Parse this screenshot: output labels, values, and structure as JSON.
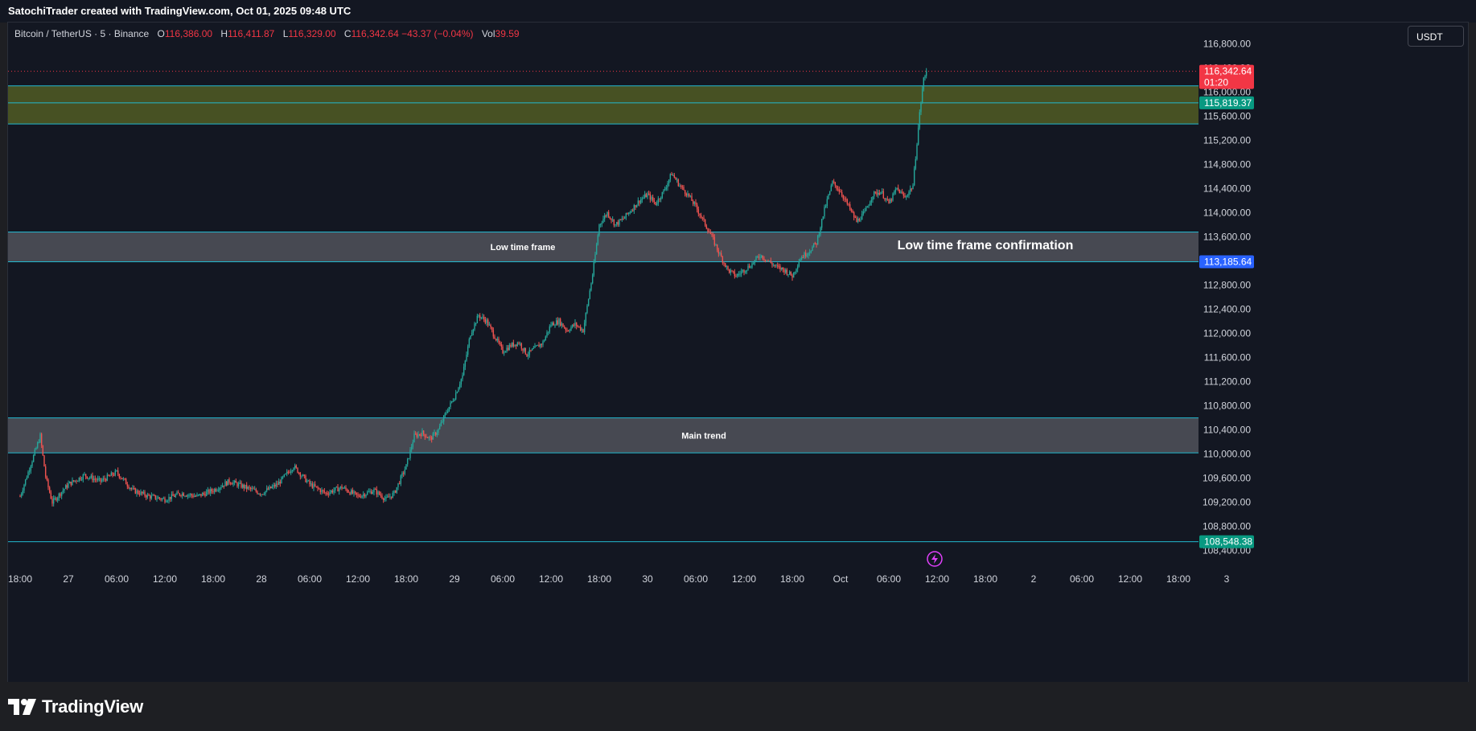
{
  "header": {
    "title": "SatochiTrader created with TradingView.com, Oct 01, 2025 09:48 UTC"
  },
  "legend": {
    "symbol": "Bitcoin / TetherUS · 5 · Binance",
    "o_label": "O",
    "o_value": "116,386.00",
    "h_label": "H",
    "h_value": "116,411.87",
    "l_label": "L",
    "l_value": "116,329.00",
    "c_label": "C",
    "c_value": "116,342.64",
    "change": "−43.37 (−0.04%)",
    "vol_label": "Vol",
    "vol_value": "39.59"
  },
  "currency_button": "USDT",
  "footer": {
    "brand": "TradingView"
  },
  "colors": {
    "background": "#131722",
    "up": "#26a69a",
    "down": "#ef5350",
    "zone_line": "#22b8cf",
    "olive_zone": "#4a5424",
    "gray_zone": "#4a4c55",
    "price_label": "#f23645",
    "teal_label": "#089981",
    "blue_label": "#2962ff"
  },
  "chart_data": {
    "type": "candlestick",
    "ylim": [
      108250,
      117150
    ],
    "y_ticks": [
      108400,
      108800,
      109200,
      109600,
      110000,
      110400,
      110800,
      111200,
      111600,
      112000,
      112400,
      112800,
      113200,
      113600,
      114000,
      114400,
      114800,
      115200,
      115600,
      116000,
      116400,
      116800
    ],
    "y_tick_labels": [
      "108,400.00",
      "108,800.00",
      "109,200.00",
      "109,600.00",
      "110,000.00",
      "110,400.00",
      "110,800.00",
      "111,200.00",
      "111,600.00",
      "112,000.00",
      "112,400.00",
      "112,800.00",
      "113,200.00",
      "113,600.00",
      "114,000.00",
      "114,400.00",
      "114,800.00",
      "115,200.00",
      "115,600.00",
      "116,000.00",
      "116,400.00",
      "116,800.00"
    ],
    "x_tick_labels": [
      "18:00",
      "27",
      "06:00",
      "12:00",
      "18:00",
      "28",
      "06:00",
      "12:00",
      "18:00",
      "29",
      "06:00",
      "12:00",
      "18:00",
      "30",
      "06:00",
      "12:00",
      "18:00",
      "Oct",
      "06:00",
      "12:00",
      "18:00",
      "2",
      "06:00",
      "12:00",
      "18:00",
      "3"
    ],
    "x_tick_hours": [
      0,
      6,
      12,
      18,
      24,
      30,
      36,
      42,
      48,
      54,
      60,
      66,
      72,
      78,
      84,
      90,
      96,
      102,
      108,
      114,
      120,
      126,
      132,
      138,
      144,
      150
    ],
    "x_range_hours": [
      -1.5,
      180
    ],
    "last_candle_hour": 112.8,
    "price_path": [
      [
        0,
        109300
      ],
      [
        1,
        109700
      ],
      [
        2.5,
        110300
      ],
      [
        3.2,
        109600
      ],
      [
        4,
        109200
      ],
      [
        6,
        109500
      ],
      [
        8,
        109650
      ],
      [
        10,
        109550
      ],
      [
        12,
        109700
      ],
      [
        14,
        109400
      ],
      [
        16,
        109300
      ],
      [
        18,
        109250
      ],
      [
        20,
        109350
      ],
      [
        22,
        109300
      ],
      [
        24,
        109400
      ],
      [
        26,
        109550
      ],
      [
        28,
        109450
      ],
      [
        30,
        109350
      ],
      [
        32,
        109500
      ],
      [
        34,
        109800
      ],
      [
        36,
        109500
      ],
      [
        38,
        109350
      ],
      [
        40,
        109450
      ],
      [
        42,
        109300
      ],
      [
        44,
        109400
      ],
      [
        45.5,
        109250
      ],
      [
        46.5,
        109350
      ],
      [
        48,
        109800
      ],
      [
        49,
        110300
      ],
      [
        50,
        110350
      ],
      [
        51,
        110250
      ],
      [
        52,
        110400
      ],
      [
        53,
        110700
      ],
      [
        54,
        110950
      ],
      [
        55,
        111300
      ],
      [
        56,
        112000
      ],
      [
        57,
        112300
      ],
      [
        58,
        112200
      ],
      [
        59,
        111950
      ],
      [
        60,
        111700
      ],
      [
        61,
        111800
      ],
      [
        62,
        111850
      ],
      [
        63,
        111650
      ],
      [
        64,
        111750
      ],
      [
        65,
        111850
      ],
      [
        66,
        112150
      ],
      [
        67,
        112200
      ],
      [
        68,
        112050
      ],
      [
        69,
        112150
      ],
      [
        70,
        112050
      ],
      [
        71.2,
        113000
      ],
      [
        72,
        113800
      ],
      [
        73,
        114000
      ],
      [
        74,
        113800
      ],
      [
        75,
        113900
      ],
      [
        76,
        114050
      ],
      [
        77,
        114200
      ],
      [
        78,
        114300
      ],
      [
        79,
        114150
      ],
      [
        80,
        114350
      ],
      [
        81,
        114650
      ],
      [
        82,
        114450
      ],
      [
        83,
        114300
      ],
      [
        84,
        114100
      ],
      [
        85,
        113850
      ],
      [
        86,
        113600
      ],
      [
        87,
        113300
      ],
      [
        88,
        113050
      ],
      [
        89,
        112950
      ],
      [
        90,
        113050
      ],
      [
        91,
        113150
      ],
      [
        92,
        113300
      ],
      [
        93,
        113200
      ],
      [
        94,
        113100
      ],
      [
        95,
        113050
      ],
      [
        96,
        112950
      ],
      [
        97,
        113250
      ],
      [
        98,
        113350
      ],
      [
        99,
        113500
      ],
      [
        100,
        114050
      ],
      [
        101,
        114500
      ],
      [
        102,
        114350
      ],
      [
        103,
        114100
      ],
      [
        104,
        113850
      ],
      [
        105,
        114000
      ],
      [
        106,
        114300
      ],
      [
        107,
        114350
      ],
      [
        108,
        114150
      ],
      [
        109,
        114400
      ],
      [
        110,
        114250
      ],
      [
        111,
        114450
      ],
      [
        111.8,
        115600
      ],
      [
        112.3,
        116200
      ],
      [
        112.8,
        116342.64
      ]
    ],
    "zones": [
      {
        "label": "",
        "low": 115470,
        "high": 116100,
        "mid": 115819.37,
        "style": "olive"
      },
      {
        "label": "Low time frame",
        "low": 113185.64,
        "high": 113680,
        "style": "gray",
        "label_x_hour": 62.5,
        "label_size": "small"
      },
      {
        "label": "Main trend",
        "low": 110020,
        "high": 110600,
        "style": "gray",
        "label_x_hour": 85,
        "label_size": "small"
      }
    ],
    "annotations": [
      {
        "text": "Low time frame confirmation",
        "x_hour": 120,
        "y": 113460,
        "size": "large"
      }
    ],
    "support_line": 108548.38,
    "price_labels": [
      {
        "value": "116,342.64",
        "sub": "01:20",
        "y": 116342.64,
        "color": "#f23645"
      },
      {
        "value": "115,819.37",
        "y": 115819.37,
        "color": "#089981"
      },
      {
        "value": "113,185.64",
        "y": 113185.64,
        "color": "#2962ff"
      },
      {
        "value": "108,548.38",
        "y": 108548.38,
        "color": "#089981"
      }
    ]
  }
}
